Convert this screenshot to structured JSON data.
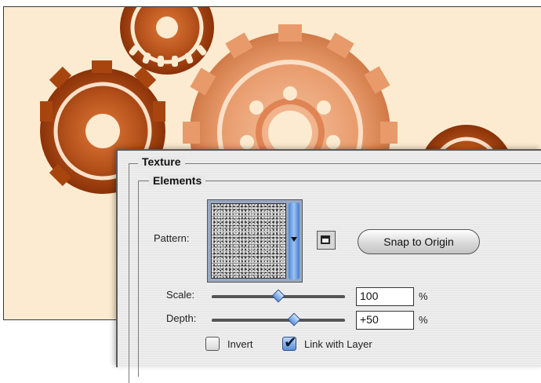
{
  "dialog": {
    "group_title": "Texture",
    "subgroup_title": "Elements",
    "pattern_label": "Pattern:",
    "snap_button_label": "Snap to Origin",
    "scale_label": "Scale:",
    "scale_value": "100",
    "scale_unit": "%",
    "scale_slider_fraction": 0.5,
    "depth_label": "Depth:",
    "depth_value": "+50",
    "depth_unit": "%",
    "depth_slider_fraction": 0.62,
    "invert_label": "Invert",
    "invert_checked": false,
    "link_label": "Link with Layer",
    "link_checked": true
  },
  "icons": {
    "pattern_dropdown": "chevron-down-icon",
    "new_preset": "new-preset-icon"
  },
  "colors": {
    "canvas_background": "#fcebd0",
    "gear_dark": "#b04a12",
    "gear_light": "#e39a6a",
    "accent": "#4a87d8"
  }
}
